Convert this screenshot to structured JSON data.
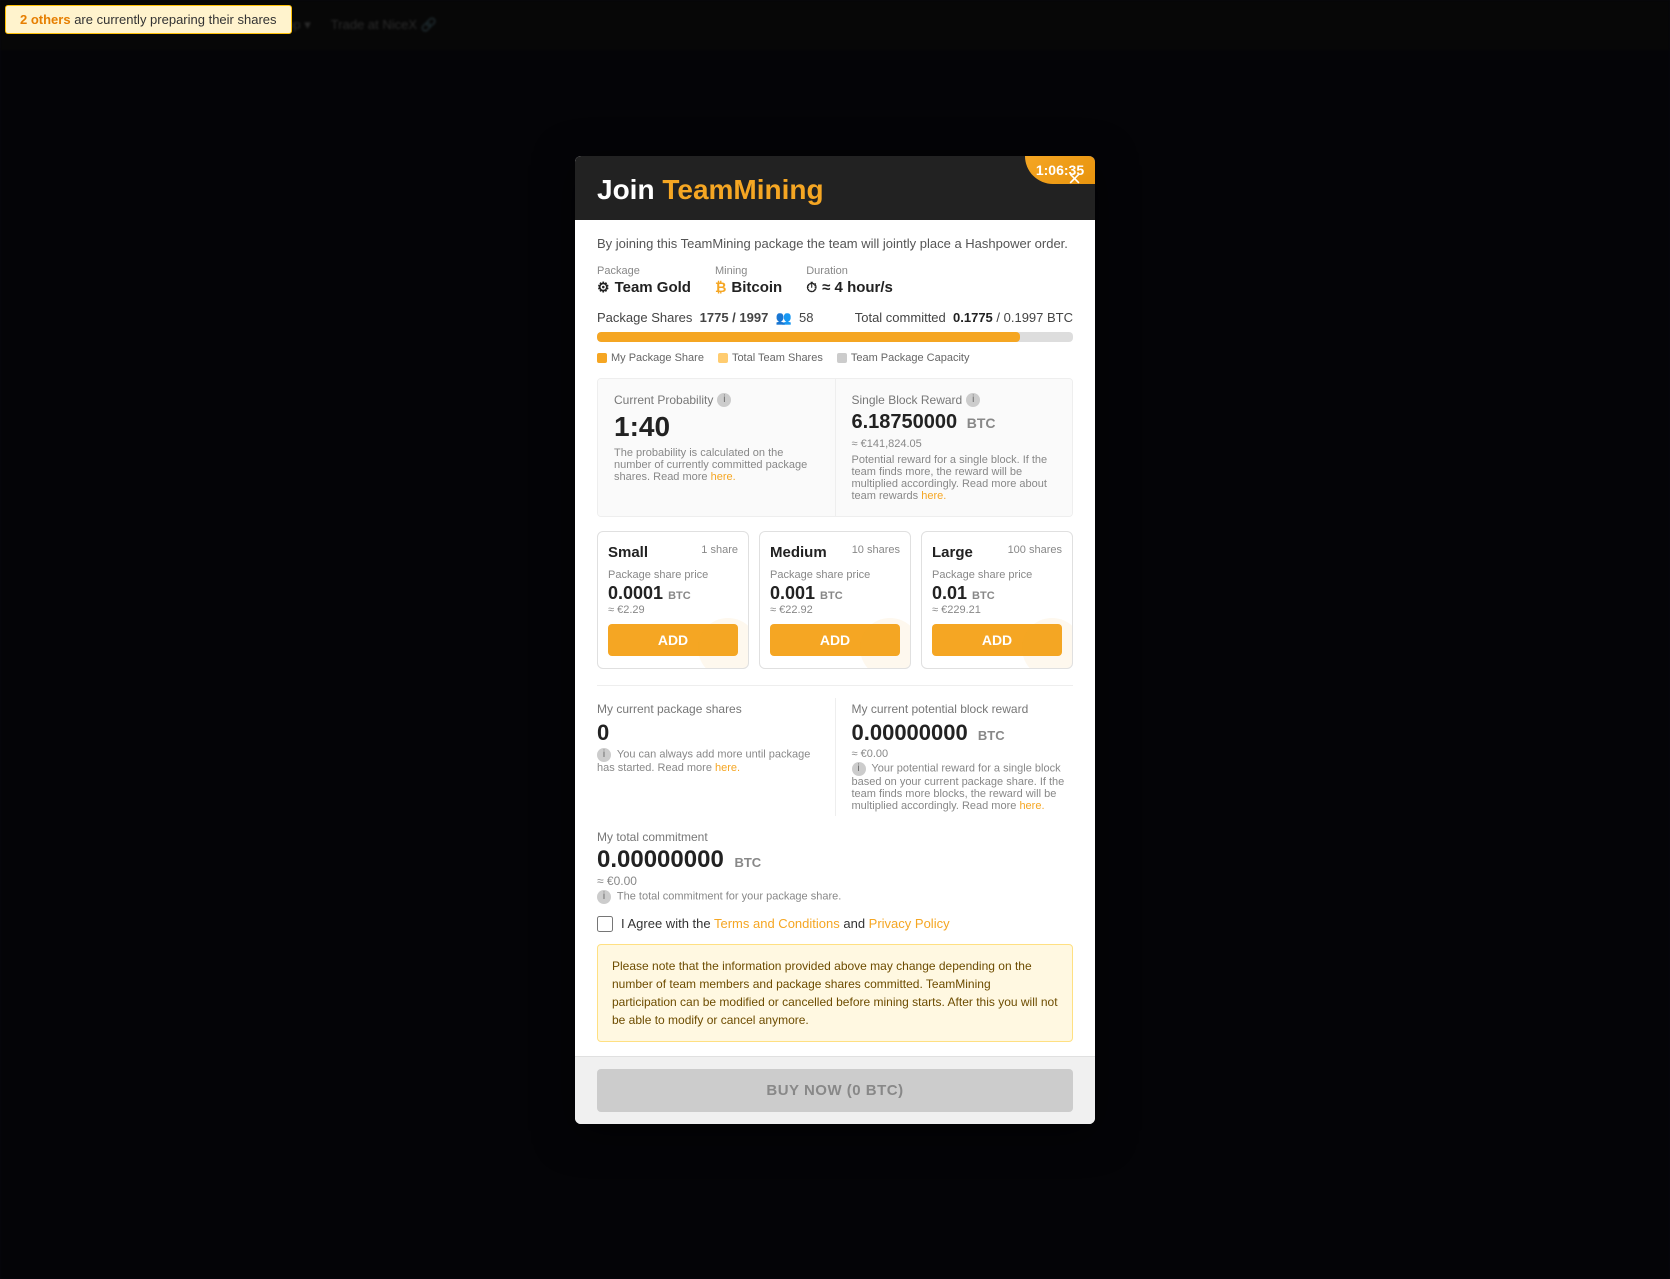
{
  "notification": {
    "text_prefix": "2 others",
    "text_suffix": " are currently preparing their shares"
  },
  "modal": {
    "title_plain": "Join ",
    "title_brand": "TeamMining",
    "subtitle": "By joining this TeamMining package the team will jointly place a Hashpower order.",
    "close_label": "×",
    "timer": "1:06:35",
    "package": {
      "label": "Package",
      "value": "Team Gold",
      "icon": "⚙"
    },
    "mining": {
      "label": "Mining",
      "value": "Bitcoin",
      "icon": "₿"
    },
    "duration": {
      "label": "Duration",
      "value": "≈ 4 hour/s",
      "icon": "⏱"
    },
    "shares": {
      "label": "Package Shares",
      "count": "1775 / 1997",
      "team_members": "58",
      "total_committed_label": "Total committed",
      "total_committed_value": "0.1775",
      "total_committed_max": "0.1997 BTC"
    },
    "legend": {
      "my_share": "My Package Share",
      "team_shares": "Total Team Shares",
      "capacity": "Team Package Capacity"
    },
    "current_probability": {
      "label": "Current Probability",
      "value": "1:40",
      "note": "The probability is calculated on the number of currently committed package shares. Read more",
      "note_link": "here."
    },
    "single_block_reward": {
      "label": "Single Block Reward",
      "value": "6.18750000",
      "btc": "BTC",
      "eur": "≈ €141,824.05",
      "note": "Potential reward for a single block. If the team finds more, the reward will be multiplied accordingly. Read more about team rewards",
      "note_link": "here."
    },
    "packages": [
      {
        "name": "Small",
        "shares": "1 share",
        "share_price_label": "Package share price",
        "price": "0.0001",
        "price_btc": "BTC",
        "price_eur": "≈ €2.29",
        "btn_label": "ADD"
      },
      {
        "name": "Medium",
        "shares": "10 shares",
        "share_price_label": "Package share price",
        "price": "0.001",
        "price_btc": "BTC",
        "price_eur": "≈ €22.92",
        "btn_label": "ADD"
      },
      {
        "name": "Large",
        "shares": "100 shares",
        "share_price_label": "Package share price",
        "price": "0.01",
        "price_btc": "BTC",
        "price_eur": "≈ €229.21",
        "btn_label": "ADD"
      }
    ],
    "my_shares": {
      "label": "My current package shares",
      "value": "0",
      "note": "You can always add more until package has started. Read more",
      "note_link": "here."
    },
    "my_reward": {
      "label": "My current potential block reward",
      "value": "0.00000000",
      "btc": "BTC",
      "eur": "≈ €0.00",
      "note": "Your potential reward for a single block based on your current package share. If the team finds more blocks, the reward will be multiplied accordingly. Read more",
      "note_link": "here."
    },
    "total_commitment": {
      "label": "My total commitment",
      "value": "0.00000000",
      "btc": "BTC",
      "eur": "≈ €0.00",
      "note": "The total commitment for your package share."
    },
    "checkbox": {
      "label_prefix": "I Agree with the ",
      "terms_label": "Terms and Conditions",
      "label_middle": " and ",
      "privacy_label": "Privacy Policy"
    },
    "notice": "Please note that the information provided above may change depending on the number of team members and package shares committed. TeamMining participation can be modified or cancelled before mining starts. After this you will not be able to modify or cancel anymore.",
    "buy_btn": "BUY NOW (0 BTC)"
  }
}
